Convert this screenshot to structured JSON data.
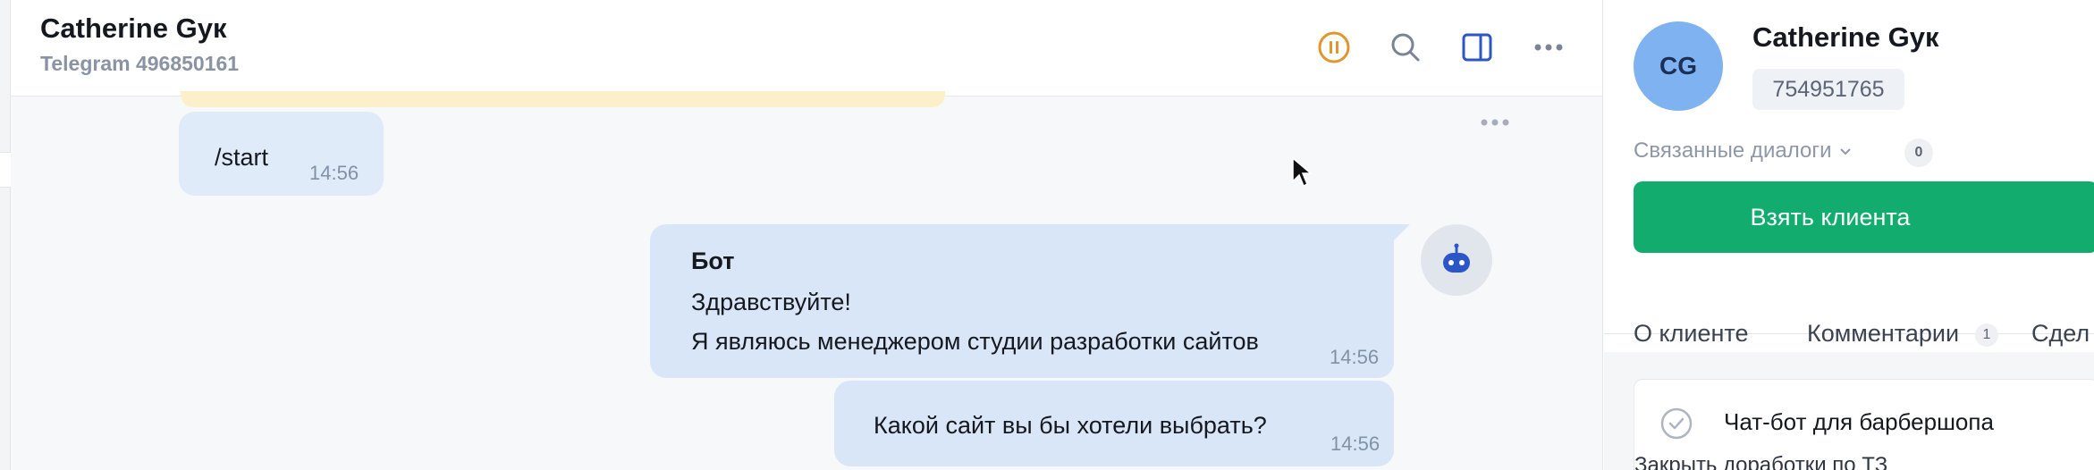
{
  "chat": {
    "title": "Catherine Gyк",
    "subtitle": "Telegram 496850161",
    "header_icons": [
      "pause-icon",
      "search-icon",
      "sidebar-toggle-icon",
      "more-icon"
    ],
    "messages": [
      {
        "text": "/start",
        "time": "14:56"
      },
      {
        "sender": "Бот",
        "line1": "Здравствуйте!",
        "line2": "Я являюсь менеджером студии разработки сайтов",
        "time": "14:56"
      },
      {
        "text": "Какой сайт вы бы хотели выбрать?",
        "time": "14:56"
      }
    ]
  },
  "panel": {
    "avatar_initials": "CG",
    "name": "Catherine Gyк",
    "client_id": "754951765",
    "linked_label": "Связанные диалоги",
    "linked_count": "0",
    "take_button": "Взять клиента",
    "tabs": [
      {
        "label": "О клиенте"
      },
      {
        "label": "Комментарии",
        "badge": "1"
      },
      {
        "label": "Сдел"
      }
    ],
    "task": {
      "title": "Чат-бот для барбершопа",
      "subtitle": "Закрыть доработки по ТЗ"
    }
  },
  "colors": {
    "accent_green": "#12ad6e",
    "bubble_blue": "#d8e6f8",
    "pause_orange": "#e0962a",
    "icon_blue": "#2c56c8"
  }
}
